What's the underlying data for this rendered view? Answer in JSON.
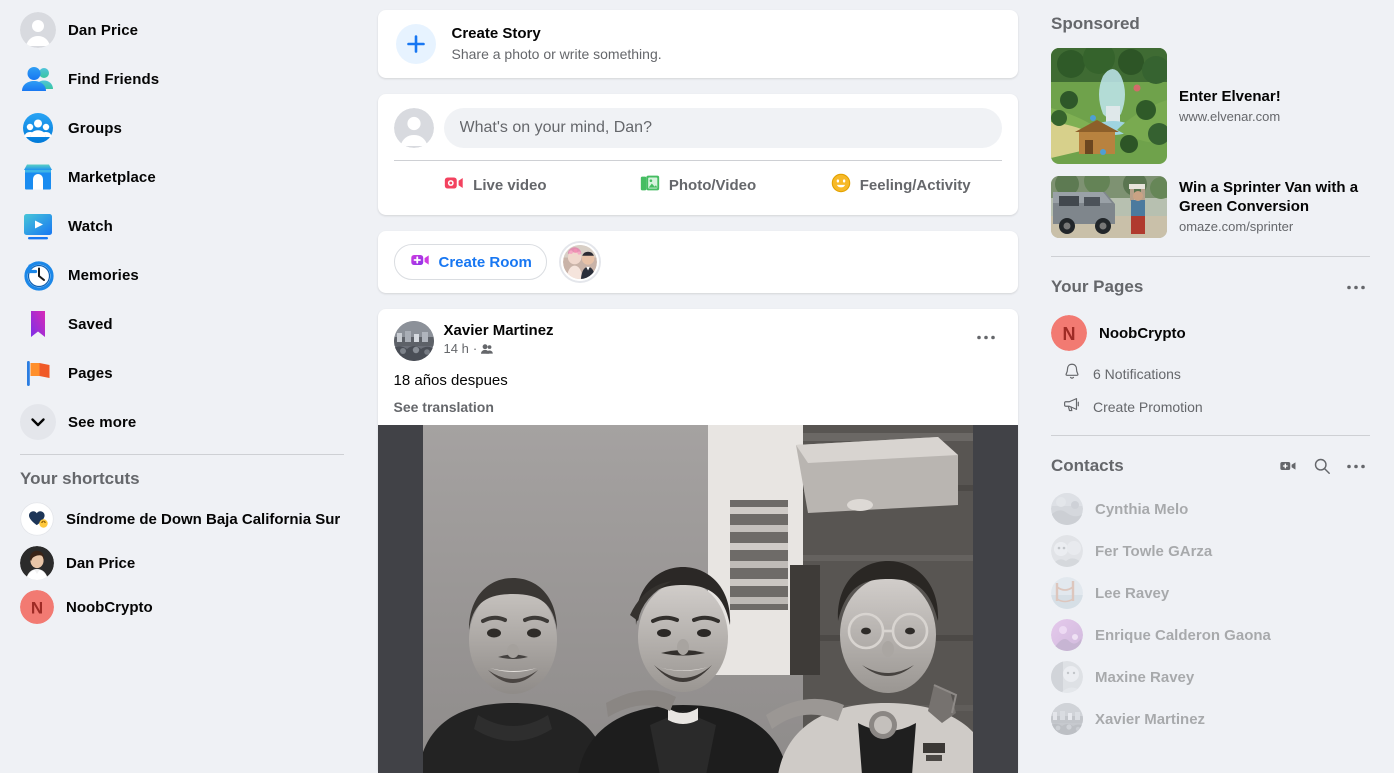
{
  "sidebar": {
    "nav_items": [
      {
        "label": "Dan Price",
        "icon": "user-avatar-icon"
      },
      {
        "label": "Find Friends",
        "icon": "find-friends-icon"
      },
      {
        "label": "Groups",
        "icon": "groups-icon"
      },
      {
        "label": "Marketplace",
        "icon": "marketplace-icon"
      },
      {
        "label": "Watch",
        "icon": "watch-icon"
      },
      {
        "label": "Memories",
        "icon": "memories-icon"
      },
      {
        "label": "Saved",
        "icon": "saved-icon"
      },
      {
        "label": "Pages",
        "icon": "pages-flag-icon"
      },
      {
        "label": "See more",
        "icon": "chevron-down-icon"
      }
    ],
    "shortcuts_heading": "Your shortcuts",
    "shortcuts": [
      {
        "label": "Síndrome de Down Baja California Sur",
        "avatar": "down-syndrome-group-avatar"
      },
      {
        "label": "Dan Price",
        "avatar": "dan-price-avatar"
      },
      {
        "label": "NoobCrypto",
        "avatar": "noobcrypto-avatar",
        "initial": "N"
      }
    ]
  },
  "feed": {
    "create_story": {
      "title": "Create Story",
      "subtitle": "Share a photo or write something.",
      "icon": "plus-icon"
    },
    "composer": {
      "placeholder": "What's on your mind, Dan?",
      "value": "",
      "actions": [
        {
          "label": "Live video",
          "icon": "live-video-icon"
        },
        {
          "label": "Photo/Video",
          "icon": "photo-video-icon"
        },
        {
          "label": "Feeling/Activity",
          "icon": "feeling-activity-icon"
        }
      ]
    },
    "rooms": {
      "create_room_label": "Create Room",
      "create_room_icon": "video-plus-icon",
      "story_avatar": "wedding-story-avatar"
    },
    "post": {
      "author": "Xavier Martinez",
      "time": "14 h",
      "time_separator": "·",
      "privacy_icon": "friends-privacy-icon",
      "more_icon": "more-horizontal-icon",
      "text": "18 años despues",
      "see_translation": "See translation",
      "photo_alt": "black-and-white-photo-three-men"
    }
  },
  "rightbar": {
    "sponsored_heading": "Sponsored",
    "ads": [
      {
        "title": "Enter Elvenar!",
        "url": "www.elvenar.com",
        "thumb": "elvenar-game-thumb"
      },
      {
        "title": "Win a Sprinter Van with a Green Conversion",
        "url": "omaze.com/sprinter",
        "thumb": "sprinter-van-thumb"
      }
    ],
    "pages_heading": "Your Pages",
    "pages_more_icon": "more-horizontal-icon",
    "pages": [
      {
        "name": "NoobCrypto",
        "initial": "N",
        "avatar_color": "#f27a72",
        "sub_items": [
          {
            "label": "6 Notifications",
            "icon": "bell-icon"
          },
          {
            "label": "Create Promotion",
            "icon": "megaphone-icon"
          }
        ]
      }
    ],
    "contacts_heading": "Contacts",
    "contacts_actions": [
      {
        "icon": "video-plus-icon",
        "name": "new-video-room"
      },
      {
        "icon": "search-icon",
        "name": "search-contacts"
      },
      {
        "icon": "more-horizontal-icon",
        "name": "contacts-options"
      }
    ],
    "contacts": [
      {
        "name": "Cynthia Melo",
        "avatar": "cynthia-melo-avatar"
      },
      {
        "name": "Fer Towle GArza",
        "avatar": "fer-towle-garza-avatar"
      },
      {
        "name": "Lee Ravey",
        "avatar": "lee-ravey-avatar"
      },
      {
        "name": "Enrique Calderon Gaona",
        "avatar": "enrique-calderon-gaona-avatar"
      },
      {
        "name": "Maxine Ravey",
        "avatar": "maxine-ravey-avatar"
      },
      {
        "name": "Xavier Martinez",
        "avatar": "xavier-martinez-avatar"
      }
    ]
  },
  "colors": {
    "accent": "#1877f2",
    "background": "#eff1f5",
    "card": "#ffffff",
    "text_primary": "#050505",
    "text_secondary": "#65676b",
    "live_video": "#f3425f",
    "photo_video": "#45bd62",
    "feeling": "#f7b928",
    "page_avatar": "#f27a72"
  }
}
